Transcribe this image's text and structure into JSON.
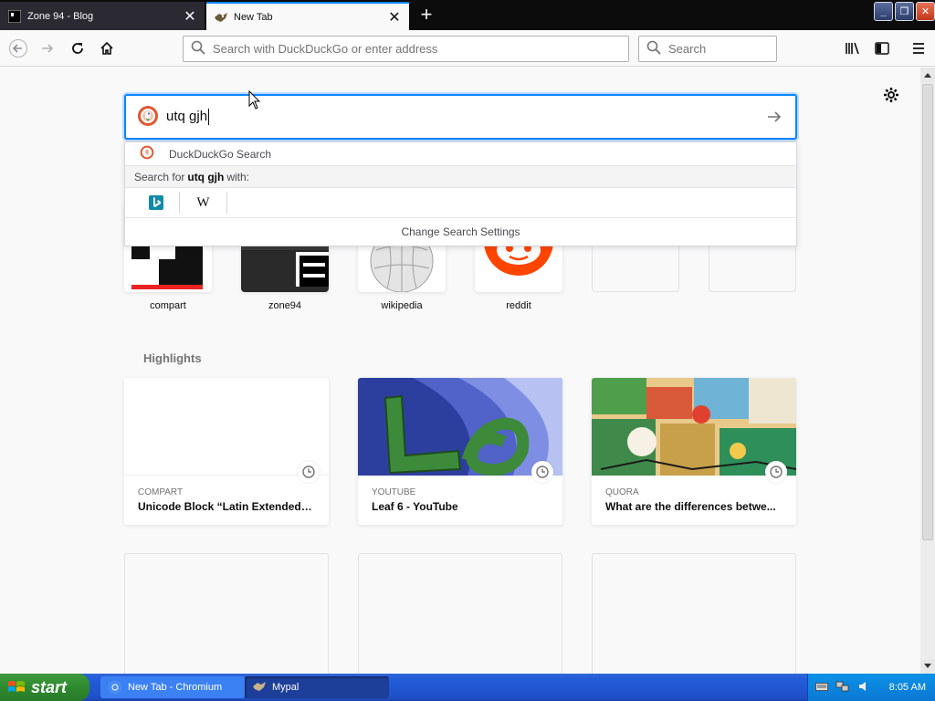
{
  "browser": {
    "tabs": [
      {
        "title": "Zone 94 - Blog",
        "active": false
      },
      {
        "title": "New Tab",
        "active": true
      }
    ],
    "urlbar_placeholder": "Search with DuckDuckGo or enter address",
    "searchbar_placeholder": "Search"
  },
  "newtab": {
    "search_text": "utq gjh",
    "dropdown": {
      "first_row": "DuckDuckGo Search",
      "search_for_prefix": "Search for",
      "search_for_query": "utq gjh",
      "search_for_suffix": "with:",
      "engines": [
        "bing",
        "wikipedia"
      ],
      "wiki_glyph": "W",
      "change_settings": "Change Search Settings"
    },
    "top_sites": [
      {
        "name": "compart"
      },
      {
        "name": "zone94"
      },
      {
        "name": "wikipedia"
      },
      {
        "name": "reddit"
      },
      {
        "name": ""
      },
      {
        "name": ""
      }
    ],
    "highlights_title": "Highlights",
    "highlights": [
      {
        "source": "COMPART",
        "title": "Unicode Block “Latin Extended-B”"
      },
      {
        "source": "YOUTUBE",
        "title": "Leaf 6 - YouTube"
      },
      {
        "source": "QUORA",
        "title": "What are the differences betwe..."
      }
    ]
  },
  "taskbar": {
    "start_label": "start",
    "items": [
      {
        "label": "New Tab - Chromium"
      },
      {
        "label": "Mypal"
      }
    ],
    "clock": "8:05 AM"
  },
  "colors": {
    "accent": "#0a84ff",
    "reddit": "#ff4500",
    "taskbar": "#245dda"
  }
}
